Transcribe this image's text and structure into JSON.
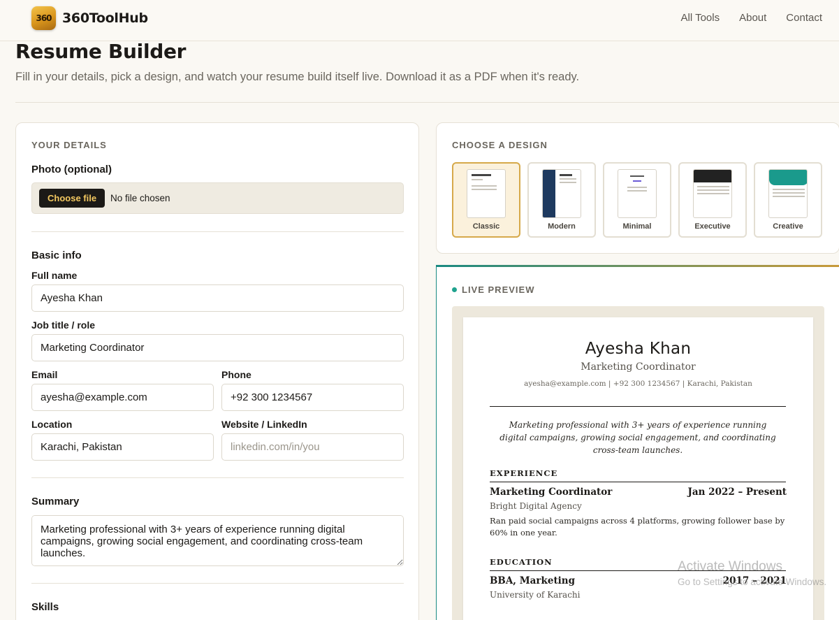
{
  "header": {
    "logo_text": "360",
    "brand": "360ToolHub",
    "nav": [
      "All Tools",
      "About",
      "Contact"
    ]
  },
  "page": {
    "title": "Resume Builder",
    "subtitle": "Fill in your details, pick a design, and watch your resume build itself live. Download it as a PDF when it's ready."
  },
  "details": {
    "heading": "YOUR DETAILS",
    "photo_label": "Photo (optional)",
    "file_button": "Choose file",
    "file_status": "No file chosen",
    "basic_heading": "Basic info",
    "full_name_label": "Full name",
    "full_name": "Ayesha Khan",
    "job_title_label": "Job title / role",
    "job_title": "Marketing Coordinator",
    "email_label": "Email",
    "email": "ayesha@example.com",
    "phone_label": "Phone",
    "phone": "+92 300 1234567",
    "location_label": "Location",
    "location": "Karachi, Pakistan",
    "website_label": "Website / LinkedIn",
    "website": "",
    "website_placeholder": "linkedin.com/in/you",
    "summary_heading": "Summary",
    "summary": "Marketing professional with 3+ years of experience running digital campaigns, growing social engagement, and coordinating cross-team launches.",
    "skills_heading": "Skills"
  },
  "design": {
    "heading": "CHOOSE A DESIGN",
    "options": [
      "Classic",
      "Modern",
      "Minimal",
      "Executive",
      "Creative"
    ],
    "selected": "Classic"
  },
  "preview": {
    "heading": "LIVE PREVIEW",
    "name": "Ayesha Khan",
    "role": "Marketing Coordinator",
    "contact": "ayesha@example.com | +92 300 1234567 | Karachi, Pakistan",
    "summary": "Marketing professional with 3+ years of experience running digital campaigns, growing social engagement, and coordinating cross-team launches.",
    "experience_heading": "EXPERIENCE",
    "job_title": "Marketing Coordinator",
    "job_dates": "Jan 2022 – Present",
    "job_org": "Bright Digital Agency",
    "job_desc": "Ran paid social campaigns across 4 platforms, growing follower base by 60% in one year.",
    "education_heading": "EDUCATION",
    "degree": "BBA, Marketing",
    "edu_dates": "2017 – 2021",
    "school": "University of Karachi"
  },
  "overlay": {
    "line1": "Activate Windows",
    "line2": "Go to Settings to activate Windows."
  }
}
